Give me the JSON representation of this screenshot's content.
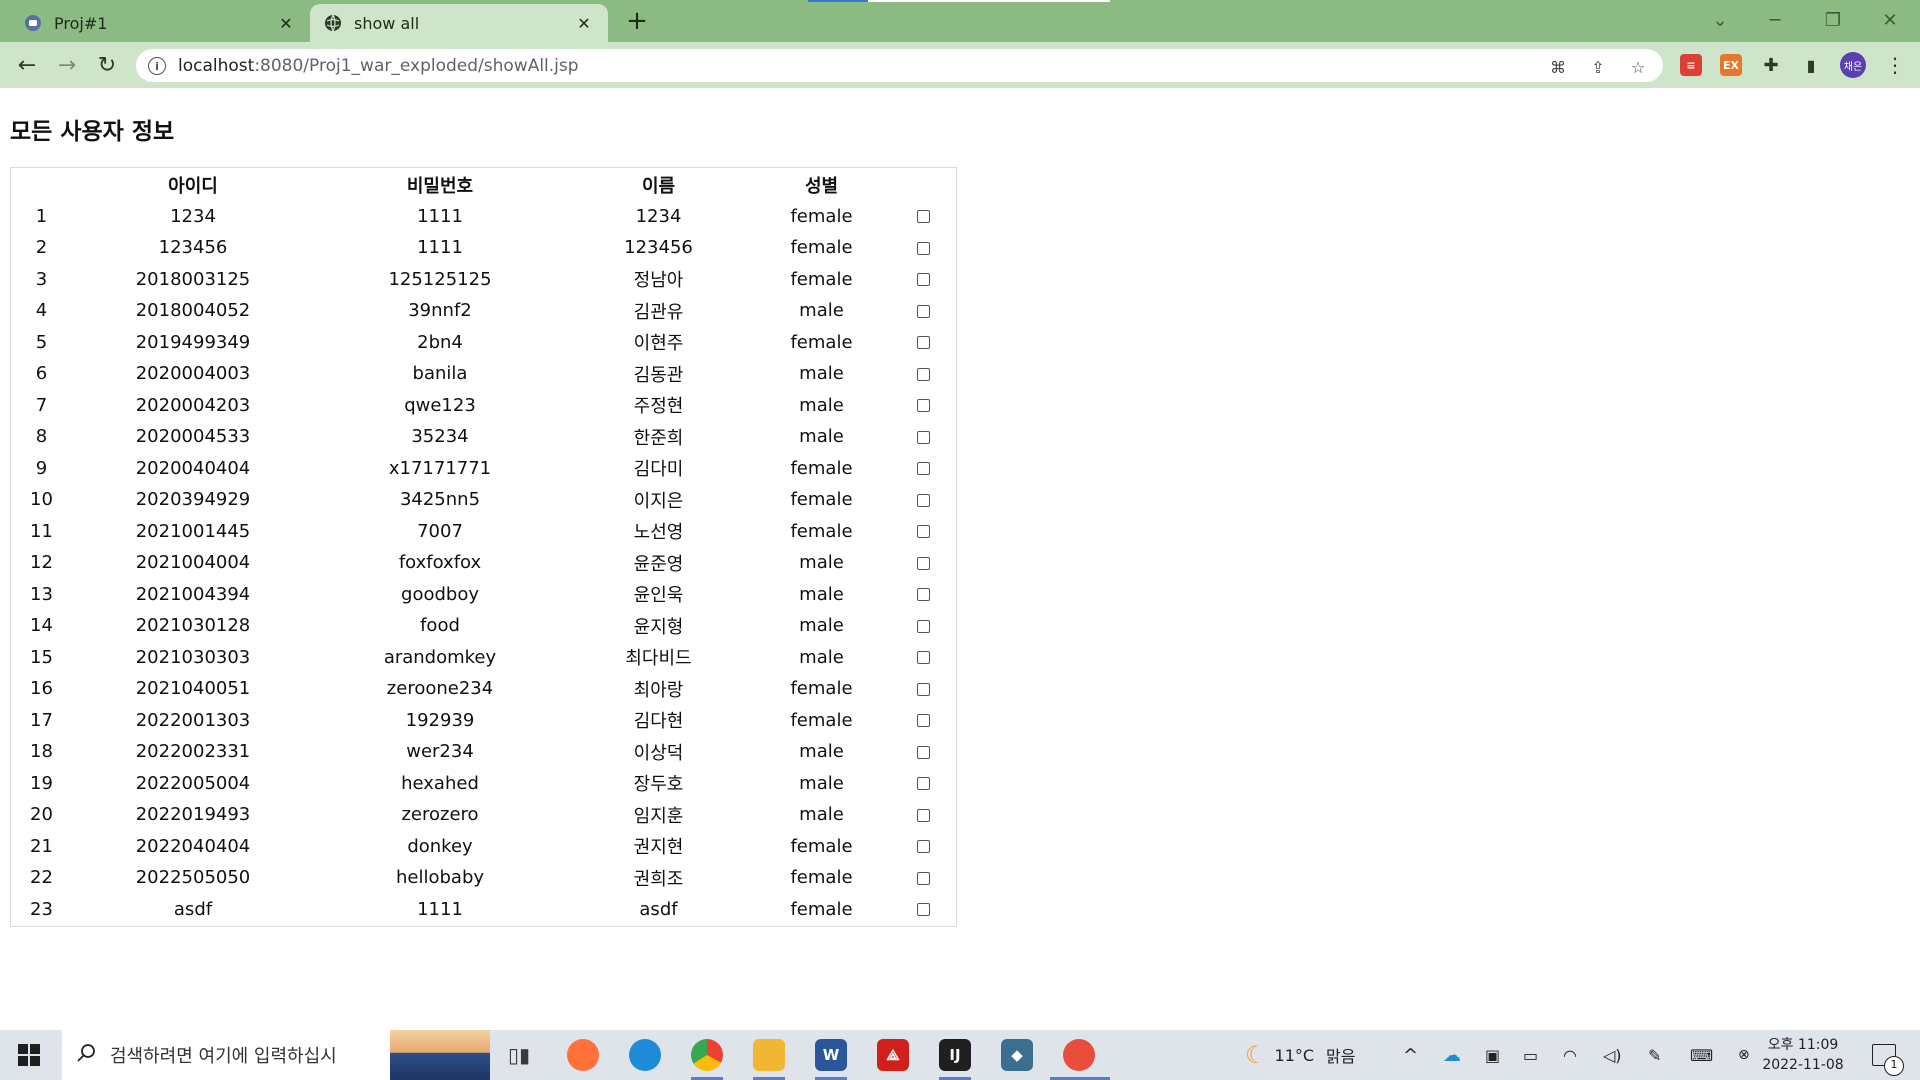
{
  "browser": {
    "tabs": [
      {
        "title": "Proj#1",
        "active": false
      },
      {
        "title": "show all",
        "active": true
      }
    ],
    "url_host": "localhost",
    "url_rest": ":8080/Proj1_war_exploded/showAll.jsp",
    "profile_initials": "채은",
    "extensions": [
      {
        "name": "todoist-extension",
        "color": "#db4035"
      },
      {
        "name": "ex-extension",
        "color": "#e8762d",
        "label": "EX"
      }
    ]
  },
  "page": {
    "title": "모든 사용자 정보",
    "columns": [
      "아이디",
      "비밀번호",
      "이름",
      "성별"
    ],
    "rows": [
      {
        "no": "1",
        "id": "1234",
        "pw": "1111",
        "name": "1234",
        "gender": "female"
      },
      {
        "no": "2",
        "id": "123456",
        "pw": "1111",
        "name": "123456",
        "gender": "female"
      },
      {
        "no": "3",
        "id": "2018003125",
        "pw": "125125125",
        "name": "정남아",
        "gender": "female"
      },
      {
        "no": "4",
        "id": "2018004052",
        "pw": "39nnf2",
        "name": "김관유",
        "gender": "male"
      },
      {
        "no": "5",
        "id": "2019499349",
        "pw": "2bn4",
        "name": "이현주",
        "gender": "female"
      },
      {
        "no": "6",
        "id": "2020004003",
        "pw": "banila",
        "name": "김동관",
        "gender": "male"
      },
      {
        "no": "7",
        "id": "2020004203",
        "pw": "qwe123",
        "name": "주정현",
        "gender": "male"
      },
      {
        "no": "8",
        "id": "2020004533",
        "pw": "35234",
        "name": "한준희",
        "gender": "male"
      },
      {
        "no": "9",
        "id": "2020040404",
        "pw": "x17171771",
        "name": "김다미",
        "gender": "female"
      },
      {
        "no": "10",
        "id": "2020394929",
        "pw": "3425nn5",
        "name": "이지은",
        "gender": "female"
      },
      {
        "no": "11",
        "id": "2021001445",
        "pw": "7007",
        "name": "노선영",
        "gender": "female"
      },
      {
        "no": "12",
        "id": "2021004004",
        "pw": "foxfoxfox",
        "name": "윤준영",
        "gender": "male"
      },
      {
        "no": "13",
        "id": "2021004394",
        "pw": "goodboy",
        "name": "윤인욱",
        "gender": "male"
      },
      {
        "no": "14",
        "id": "2021030128",
        "pw": "food",
        "name": "윤지형",
        "gender": "male"
      },
      {
        "no": "15",
        "id": "2021030303",
        "pw": "arandomkey",
        "name": "최다비드",
        "gender": "male"
      },
      {
        "no": "16",
        "id": "2021040051",
        "pw": "zeroone234",
        "name": "최아랑",
        "gender": "female"
      },
      {
        "no": "17",
        "id": "2022001303",
        "pw": "192939",
        "name": "김다현",
        "gender": "female"
      },
      {
        "no": "18",
        "id": "2022002331",
        "pw": "wer234",
        "name": "이상덕",
        "gender": "male"
      },
      {
        "no": "19",
        "id": "2022005004",
        "pw": "hexahed",
        "name": "장두호",
        "gender": "male"
      },
      {
        "no": "20",
        "id": "2022019493",
        "pw": "zerozero",
        "name": "임지훈",
        "gender": "male"
      },
      {
        "no": "21",
        "id": "2022040404",
        "pw": "donkey",
        "name": "권지현",
        "gender": "female"
      },
      {
        "no": "22",
        "id": "2022505050",
        "pw": "hellobaby",
        "name": "권희조",
        "gender": "female"
      },
      {
        "no": "23",
        "id": "asdf",
        "pw": "1111",
        "name": "asdf",
        "gender": "female"
      }
    ]
  },
  "taskbar": {
    "search_placeholder": "검색하려면 여기에 입력하십시",
    "apps": [
      {
        "name": "task-view",
        "color": "#3a3a3a"
      },
      {
        "name": "firefox",
        "color": "#ff7139"
      },
      {
        "name": "edge",
        "color": "#1e8bd8"
      },
      {
        "name": "chrome",
        "color": "#34a853"
      },
      {
        "name": "file-explorer",
        "color": "#f2b632"
      },
      {
        "name": "word",
        "color": "#2b579a",
        "label": "W"
      },
      {
        "name": "acrobat",
        "color": "#d1201c"
      },
      {
        "name": "intellij",
        "color": "#1f1f1f",
        "label": "IJ"
      },
      {
        "name": "mysql-workbench",
        "color": "#3b6e8f"
      },
      {
        "name": "paint",
        "color": "#e94e3c"
      }
    ],
    "weather_temp": "11°C",
    "weather_desc": "맑음",
    "time": "오후 11:09",
    "date": "2022-11-08",
    "notification_count": "1"
  }
}
